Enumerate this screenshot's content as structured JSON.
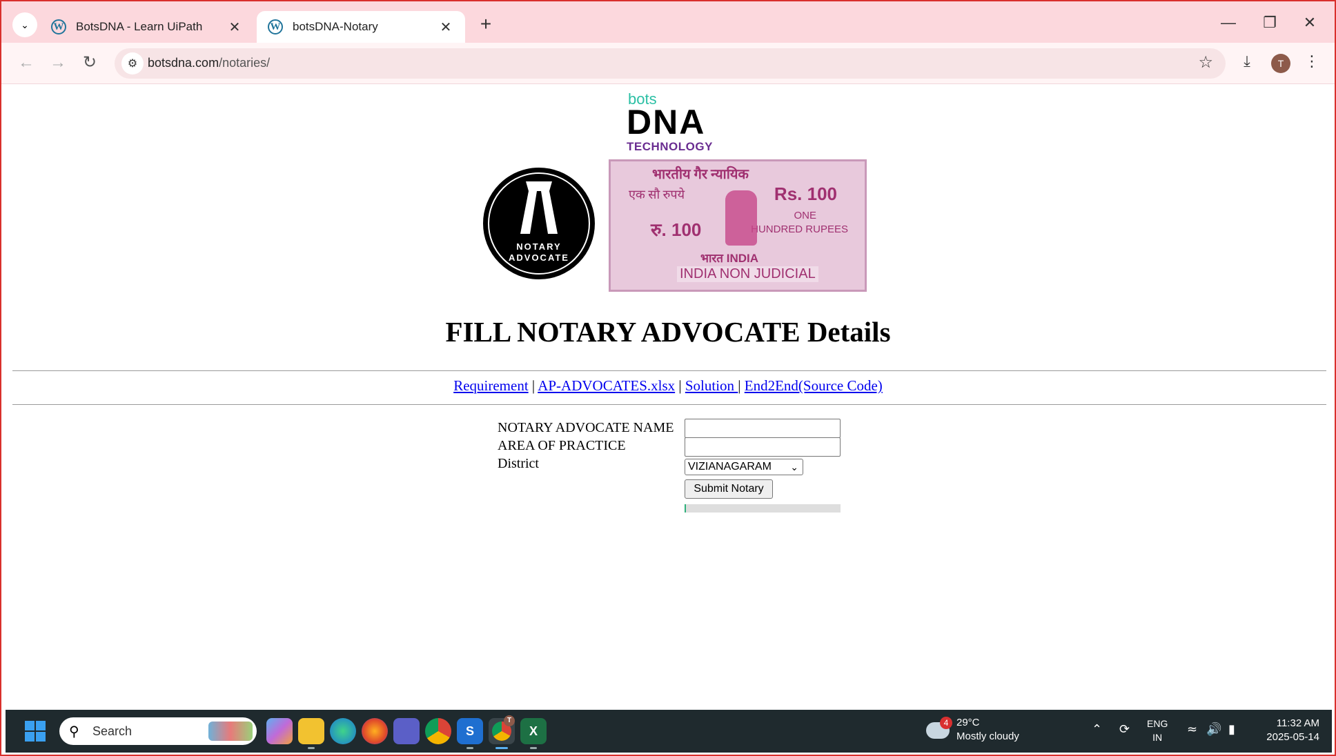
{
  "browser": {
    "tabs": [
      {
        "label": "BotsDNA - Learn UiPath",
        "active": false
      },
      {
        "label": "botsDNA-Notary",
        "active": true
      }
    ],
    "url_host": "botsdna.com",
    "url_path": "/notaries/",
    "profile_initial": "T"
  },
  "page": {
    "logo": {
      "top": "bots",
      "main": "DNA",
      "sub": "TECHNOLOGY"
    },
    "badge": {
      "line1": "NOTARY",
      "line2": "ADVOCATE"
    },
    "stamp": {
      "top": "भारतीय गैर न्यायिक",
      "left": "एक सौ रुपये",
      "rs": "Rs. 100",
      "one": "ONE",
      "hundred": "HUNDRED RUPEES",
      "ru": "रु. 100",
      "india": "भारत INDIA",
      "nonjudicial": "INDIA NON JUDICIAL"
    },
    "heading": "FILL NOTARY ADVOCATE Details",
    "links": [
      {
        "label": "Requirement"
      },
      {
        "label": "AP-ADVOCATES.xlsx"
      },
      {
        "label": "Solution "
      },
      {
        "label": "End2End(Source Code)"
      }
    ],
    "form": {
      "name_label": "NOTARY ADVOCATE NAME",
      "name_value": "",
      "area_label": "AREA OF PRACTICE",
      "area_value": "",
      "district_label": "District",
      "district_selected": "VIZIANAGARAM",
      "submit_label": "Submit Notary",
      "progress_fraction": 0.01
    }
  },
  "taskbar": {
    "search_label": "Search",
    "weather": {
      "badge": "4",
      "temp": "29°C",
      "condition": "Mostly cloudy"
    },
    "lang": {
      "line1": "ENG",
      "line2": "IN"
    },
    "clock": {
      "time": "11:32 AM",
      "date": "2025-05-14"
    },
    "chrome_badge": "T"
  }
}
